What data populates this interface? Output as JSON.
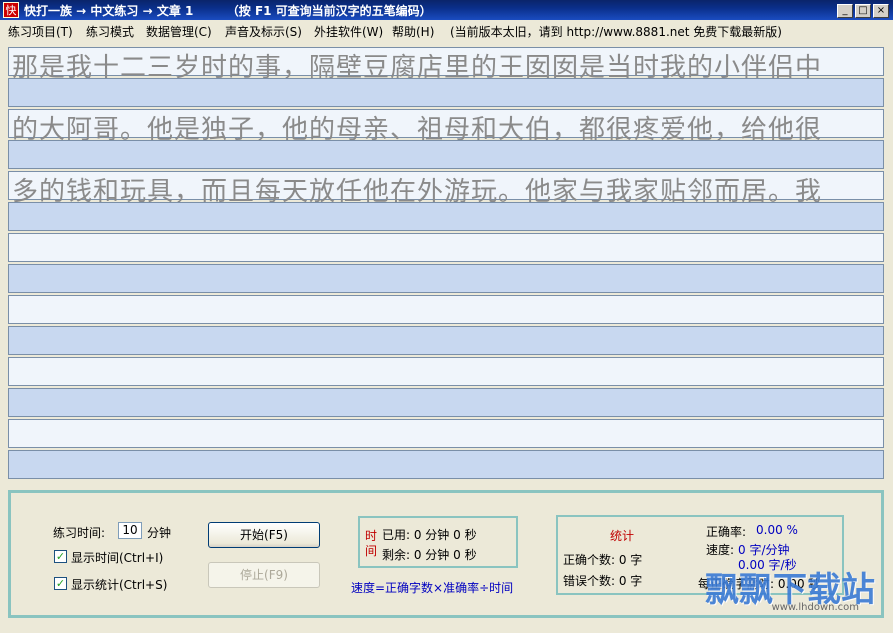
{
  "window": {
    "app_icon_glyph": "快",
    "title": "快打一族 → 中文练习 → 文章 1        （按 F1 可查询当前汉字的五笔编码）",
    "buttons": {
      "minimize": "_",
      "maximize": "□",
      "close": "×"
    }
  },
  "menu": {
    "items": [
      "练习项目(T)",
      "练习模式",
      "数据管理(C)",
      "声音及标示(S)",
      "外挂软件(W)",
      "帮助(H)"
    ],
    "notice": "(当前版本太旧，请到 http://www.8881.net 免费下载最新版)"
  },
  "article_lines": [
    "那是我十二三岁时的事，隔壁豆腐店里的王囡囡是当时我的小伴侣中",
    "的大阿哥。他是独子，他的母亲、祖母和大伯，都很疼爱他，给他很",
    "多的钱和玩具，而且每天放任他在外游玩。他家与我家贴邻而居。我"
  ],
  "controls": {
    "practice_time_label": "练习时间:",
    "practice_time_value": "10",
    "practice_time_unit": "分钟",
    "show_time_label": "显示时间(Ctrl+I)",
    "show_time_checked": true,
    "show_stats_label": "显示统计(Ctrl+S)",
    "show_stats_checked": true,
    "start_button": "开始(F5)",
    "stop_button": "停止(F9)"
  },
  "time_box": {
    "title_1": "时",
    "title_2": "间",
    "used": "已用: 0 分钟 0 秒",
    "remaining": "剩余: 0 分钟 0 秒"
  },
  "formula": "速度=正确字数×准确率÷时间",
  "stats": {
    "title": "统计",
    "correct_count": "正确个数: 0 字",
    "error_count": "错误个数: 0 字",
    "accuracy_label": "正确率:",
    "accuracy_value": "0.00 %",
    "speed_label": "速度:",
    "speed_min": "0 字/分钟",
    "speed_sec": "0.00 字/秒",
    "per_char_time": "每正确字需时: 0.00 秒"
  },
  "watermark": {
    "text": "飘飘下载站",
    "url": "www.lhdown.com"
  },
  "colors": {
    "title_bar": "#0a246a",
    "input_line": "#c8d8f0",
    "text_line": "#f0f5fb",
    "panel_border": "#8ac4c0",
    "value_blue": "#0000c0"
  }
}
